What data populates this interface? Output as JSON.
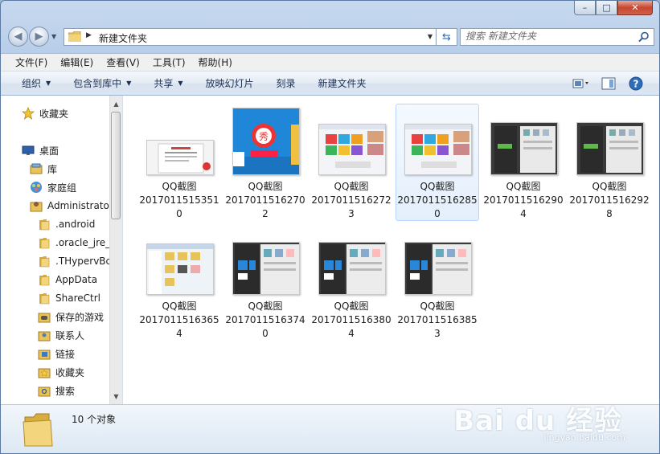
{
  "window": {
    "caption": {
      "minimize": "–",
      "maximize": "□",
      "close": "✕"
    }
  },
  "address": {
    "path": "新建文件夹"
  },
  "search": {
    "placeholder": "搜索 新建文件夹"
  },
  "menu": [
    "文件(F)",
    "编辑(E)",
    "查看(V)",
    "工具(T)",
    "帮助(H)"
  ],
  "commands": [
    {
      "label": "组织",
      "dropdown": true
    },
    {
      "label": "包含到库中",
      "dropdown": true
    },
    {
      "label": "共享",
      "dropdown": true
    },
    {
      "label": "放映幻灯片",
      "dropdown": false
    },
    {
      "label": "刻录",
      "dropdown": false
    },
    {
      "label": "新建文件夹",
      "dropdown": false
    }
  ],
  "nav": {
    "items": [
      {
        "label": "收藏夹",
        "icon": "star-icon"
      },
      {
        "label": "桌面",
        "icon": "desktop-icon"
      },
      {
        "label": "库",
        "icon": "library-icon"
      },
      {
        "label": "家庭组",
        "icon": "homegroup-icon"
      },
      {
        "label": "Administrato",
        "icon": "user-folder-icon"
      },
      {
        "label": ".android",
        "icon": "folder-icon"
      },
      {
        "label": ".oracle_jre_",
        "icon": "folder-icon"
      },
      {
        "label": ".THypervBc",
        "icon": "folder-icon"
      },
      {
        "label": "AppData",
        "icon": "folder-icon"
      },
      {
        "label": "ShareCtrl",
        "icon": "folder-icon"
      },
      {
        "label": "保存的游戏",
        "icon": "saved-games-icon"
      },
      {
        "label": "联系人",
        "icon": "contacts-icon"
      },
      {
        "label": "链接",
        "icon": "links-icon"
      },
      {
        "label": "收藏夹",
        "icon": "favorites-folder-icon"
      },
      {
        "label": "搜索",
        "icon": "searches-icon"
      }
    ]
  },
  "files": [
    {
      "line1": "QQ截图",
      "line2": "2017011515351",
      "line3": "0",
      "selected": false,
      "style": "document"
    },
    {
      "line1": "QQ截图",
      "line2": "2017011516270",
      "line3": "2",
      "selected": false,
      "style": "meitu"
    },
    {
      "line1": "QQ截图",
      "line2": "2017011516272",
      "line3": "3",
      "selected": false,
      "style": "app"
    },
    {
      "line1": "QQ截图",
      "line2": "2017011516285",
      "line3": "0",
      "selected": true,
      "style": "app"
    },
    {
      "line1": "QQ截图",
      "line2": "2017011516290",
      "line3": "4",
      "selected": false,
      "style": "dark"
    },
    {
      "line1": "QQ截图",
      "line2": "2017011516292",
      "line3": "8",
      "selected": false,
      "style": "dark"
    },
    {
      "line1": "QQ截图",
      "line2": "2017011516365",
      "line3": "4",
      "selected": false,
      "style": "explorer"
    },
    {
      "line1": "QQ截图",
      "line2": "2017011516374",
      "line3": "0",
      "selected": false,
      "style": "darkapp"
    },
    {
      "line1": "QQ截图",
      "line2": "2017011516380",
      "line3": "4",
      "selected": false,
      "style": "darkapp"
    },
    {
      "line1": "QQ截图",
      "line2": "2017011516385",
      "line3": "3",
      "selected": false,
      "style": "darkapp"
    }
  ],
  "details": {
    "count_text": "10 个对象"
  },
  "watermark": {
    "main": "Bai du 经验",
    "sub": "jingyan.baidu.com"
  },
  "colors": {
    "accent": "#2f6db8",
    "selection_bg": "#e4effc",
    "selection_border": "#b8d6fb",
    "folder": "#e8c35a"
  }
}
